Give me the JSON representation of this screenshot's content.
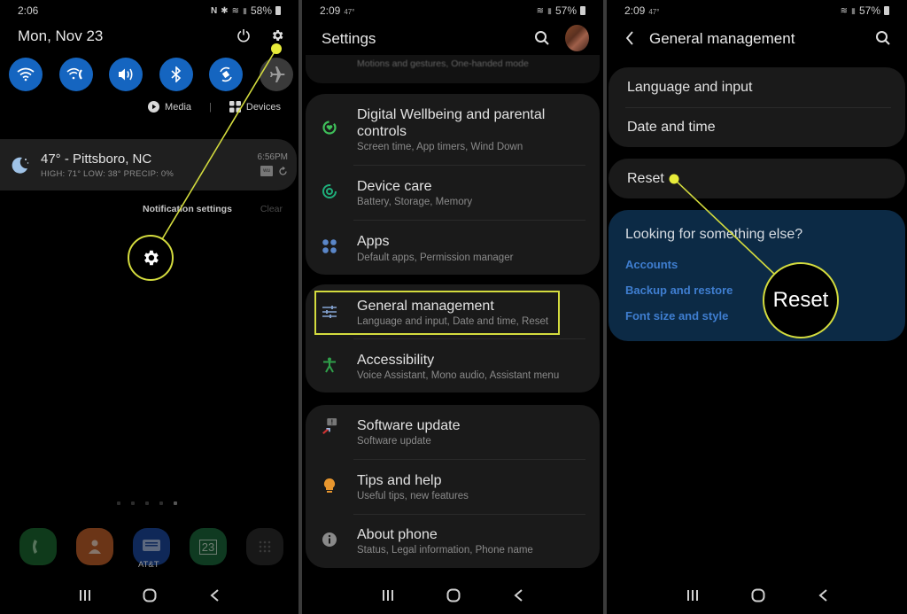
{
  "panel1": {
    "status": {
      "time": "2:06",
      "battery": "58%"
    },
    "date": "Mon, Nov 23",
    "top_icons": [
      "power-icon",
      "settings-gear-icon"
    ],
    "quick_toggles": [
      {
        "name": "wifi",
        "state": "on"
      },
      {
        "name": "wifi-calling",
        "state": "on"
      },
      {
        "name": "sound",
        "state": "on"
      },
      {
        "name": "bluetooth",
        "state": "on"
      },
      {
        "name": "auto-rotate",
        "state": "on"
      },
      {
        "name": "airplane-mode",
        "state": "off"
      }
    ],
    "media_label": "Media",
    "devices_label": "Devices",
    "weather": {
      "title": "47° - Pittsboro, NC",
      "subtitle": "HIGH: 71° LOW: 38° PRECIP: 0%",
      "time": "6:56PM",
      "badge": "wu"
    },
    "notification_settings": "Notification settings",
    "clear": "Clear",
    "dock_label": "AT&T",
    "calendar_day": "23",
    "colors": {
      "toggle_on": "#1565c0",
      "callout": "#d4dc3e"
    }
  },
  "panel2": {
    "status": {
      "time": "2:09",
      "temp": "47°",
      "battery": "57%"
    },
    "title": "Settings",
    "ghost_item": "Motions and gestures, One-handed mode",
    "groups": [
      {
        "items": [
          {
            "title": "Digital Wellbeing and parental controls",
            "desc": "Screen time, App timers, Wind Down",
            "icon": "digital-wellbeing-icon"
          },
          {
            "title": "Device care",
            "desc": "Battery, Storage, Memory",
            "icon": "device-care-icon"
          },
          {
            "title": "Apps",
            "desc": "Default apps, Permission manager",
            "icon": "apps-icon"
          }
        ]
      },
      {
        "items": [
          {
            "title": "General management",
            "desc": "Language and input, Date and time, Reset",
            "icon": "sliders-icon",
            "highlighted": true
          },
          {
            "title": "Accessibility",
            "desc": "Voice Assistant, Mono audio, Assistant menu",
            "icon": "accessibility-icon"
          }
        ]
      },
      {
        "items": [
          {
            "title": "Software update",
            "desc": "Software update",
            "icon": "software-update-icon"
          },
          {
            "title": "Tips and help",
            "desc": "Useful tips, new features",
            "icon": "lightbulb-icon"
          },
          {
            "title": "About phone",
            "desc": "Status, Legal information, Phone name",
            "icon": "info-icon"
          }
        ]
      }
    ]
  },
  "panel3": {
    "status": {
      "time": "2:09",
      "temp": "47°",
      "battery": "57%"
    },
    "title": "General management",
    "items": [
      "Language and input",
      "Date and time",
      "Reset"
    ],
    "suggest_title": "Looking for something else?",
    "suggest_links": [
      "Accounts",
      "Backup and restore",
      "Font size and style"
    ],
    "callout_label": "Reset",
    "colors": {
      "suggest_bg": "#0c2a45",
      "link": "#3f7ed0"
    }
  }
}
